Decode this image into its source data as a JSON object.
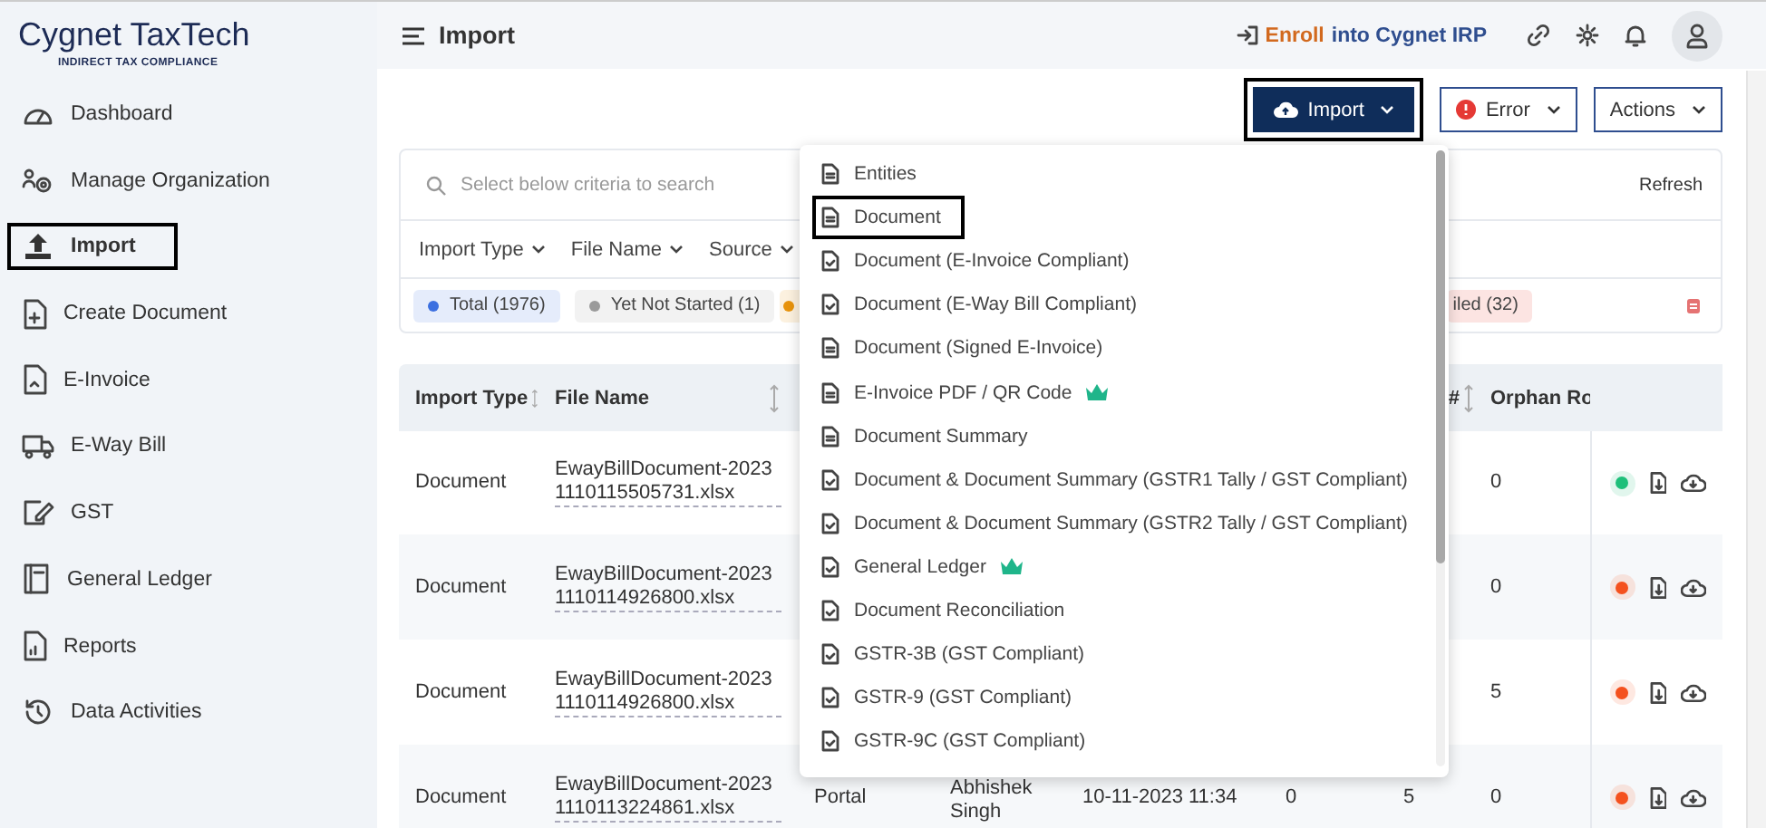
{
  "brand": {
    "name": "Cygnet TaxTech",
    "tagline": "INDIRECT TAX COMPLIANCE"
  },
  "sidebar": {
    "items": [
      {
        "label": "Dashboard",
        "highlighted": false
      },
      {
        "label": "Manage Organization",
        "highlighted": false
      },
      {
        "label": "Import",
        "highlighted": true
      },
      {
        "label": "Create Document",
        "highlighted": false
      },
      {
        "label": "E-Invoice",
        "highlighted": false
      },
      {
        "label": "E-Way Bill",
        "highlighted": false
      },
      {
        "label": "GST",
        "highlighted": false
      },
      {
        "label": "General Ledger",
        "highlighted": false
      },
      {
        "label": "Reports",
        "highlighted": false
      },
      {
        "label": "Data Activities",
        "highlighted": false
      }
    ]
  },
  "topbar": {
    "title": "Import",
    "enroll": {
      "part1": "Enroll ",
      "part2": "into Cygnet IRP"
    }
  },
  "toolbar": {
    "buttons": [
      {
        "label": "Import",
        "kind": "primary",
        "highlighted": true
      },
      {
        "label": "Error",
        "kind": "error",
        "highlighted": false
      },
      {
        "label": "Actions",
        "kind": "plain",
        "highlighted": false
      }
    ]
  },
  "filters": {
    "search": {
      "placeholder": "Select below criteria to search"
    },
    "refresh": "Refresh",
    "dropdowns": [
      "Import Type",
      "File Name",
      "Source"
    ],
    "chips": [
      {
        "label": "Total (1976)",
        "kind": "dot",
        "color": "#3b6fe0"
      },
      {
        "label": "Yet Not Started (1)",
        "kind": "dot",
        "color": "#9a9a9a"
      },
      {
        "kind": "dot",
        "color": "#e8930c"
      },
      {
        "label": "iled (32)",
        "kind": "plain",
        "color": "#fce4e2"
      }
    ]
  },
  "table": {
    "columns": [
      {
        "label": "Import Type",
        "sortable": true
      },
      {
        "label": "File Name",
        "sortable": true
      },
      null,
      null,
      null,
      null,
      {
        "label": "#",
        "sortable": true
      },
      {
        "label": "Orphan Ro",
        "sortable": false
      }
    ],
    "rows": [
      {
        "cells": [
          "Document",
          "EwayBillDocument-20231110115505731.xlsx",
          null,
          null,
          null,
          null,
          null,
          "0"
        ],
        "color": "#1fbf7a"
      },
      {
        "cells": [
          "Document",
          "EwayBillDocument-20231110114926800.xlsx",
          null,
          null,
          null,
          null,
          null,
          "0"
        ],
        "color": "#f4511e"
      },
      {
        "cells": [
          "Document",
          "EwayBillDocument-20231110114926800.xlsx",
          null,
          null,
          null,
          null,
          null,
          "5"
        ],
        "color": "#f4511e"
      },
      {
        "cells": [
          "Document",
          "EwayBillDocument-20231110113224861.xlsx",
          "Portal",
          "Abhishek Singh",
          "10-11-2023 11:34",
          "0",
          "5",
          "0"
        ],
        "color": "#f4511e"
      }
    ]
  },
  "import_menu": {
    "items": [
      {
        "label": "Entities",
        "kind": "doc",
        "premium": false,
        "highlighted": false
      },
      {
        "label": "Document",
        "kind": "doc",
        "premium": false,
        "highlighted": true
      },
      {
        "label": "Document (E-Invoice Compliant)",
        "kind": "check",
        "premium": false,
        "highlighted": false
      },
      {
        "label": "Document (E-Way Bill Compliant)",
        "kind": "check",
        "premium": false,
        "highlighted": false
      },
      {
        "label": "Document (Signed E-Invoice)",
        "kind": "doc",
        "premium": false,
        "highlighted": false
      },
      {
        "label": "E-Invoice PDF / QR Code",
        "kind": "doc",
        "premium": true,
        "highlighted": false
      },
      {
        "label": "Document Summary",
        "kind": "doc",
        "premium": false,
        "highlighted": false
      },
      {
        "label": "Document & Document Summary (GSTR1 Tally / GST Compliant)",
        "kind": "check",
        "premium": false,
        "highlighted": false
      },
      {
        "label": "Document & Document Summary (GSTR2 Tally / GST Compliant)",
        "kind": "check",
        "premium": false,
        "highlighted": false
      },
      {
        "label": "General Ledger",
        "kind": "check",
        "premium": true,
        "highlighted": false
      },
      {
        "label": "Document Reconciliation",
        "kind": "check",
        "premium": false,
        "highlighted": false
      },
      {
        "label": "GSTR-3B (GST Compliant)",
        "kind": "check",
        "premium": false,
        "highlighted": false
      },
      {
        "label": "GSTR-9 (GST Compliant)",
        "kind": "check",
        "premium": false,
        "highlighted": false
      },
      {
        "label": "GSTR-9C (GST Compliant)",
        "kind": "check",
        "premium": false,
        "highlighted": false
      }
    ]
  }
}
